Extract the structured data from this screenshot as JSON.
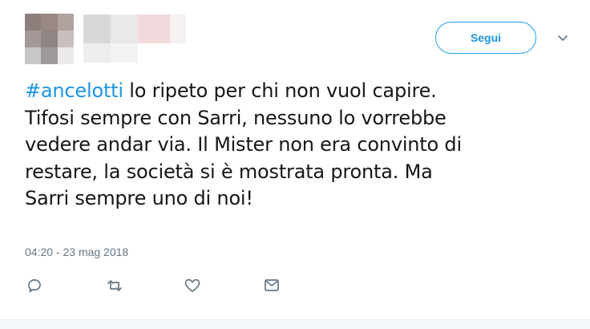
{
  "header": {
    "follow_label": "Segui"
  },
  "tweet": {
    "hashtag": "#ancelotti",
    "body_lines": [
      " lo ripeto per chi non vuol capire.",
      "Tifosi sempre con Sarri, nessuno lo vorrebbe",
      "vedere andar via. Il Mister non era convinto di",
      "restare, la società si è mostrata pronta. Ma",
      "Sarri sempre uno di noi!"
    ],
    "timestamp": "04:20 - 23 mag 2018"
  },
  "icons": {
    "reply": "reply-icon",
    "retweet": "retweet-icon",
    "like": "heart-icon",
    "message": "envelope-icon",
    "more": "chevron-down-icon"
  },
  "colors": {
    "accent": "#1da1f2",
    "link": "#1b95e0",
    "text": "#14171a",
    "muted": "#657786"
  }
}
